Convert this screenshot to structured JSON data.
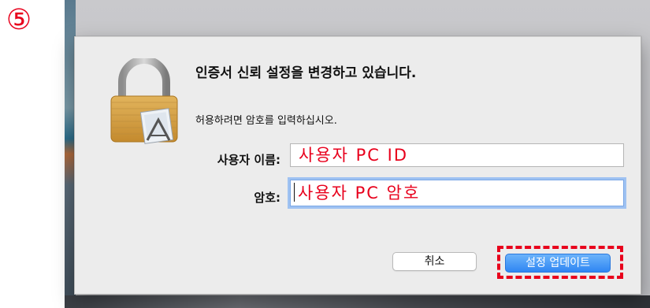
{
  "step_marker": "⑤",
  "dialog": {
    "title": "인증서 신뢰 설정을 변경하고 있습니다.",
    "subtitle": "허용하려면 암호를 입력하십시오.",
    "icon": "padlock-icon",
    "username": {
      "label": "사용자 이름:",
      "value": "사용자 PC ID"
    },
    "password": {
      "label": "암호:",
      "value": "사용자 PC 암호"
    },
    "buttons": {
      "cancel": "취소",
      "update": "설정 업데이트"
    }
  },
  "colors": {
    "annotation_red": "#e8001c",
    "primary_button_blue": "#2f86f3",
    "focus_ring": "#9fc2f2",
    "dialog_bg": "#ececec"
  }
}
